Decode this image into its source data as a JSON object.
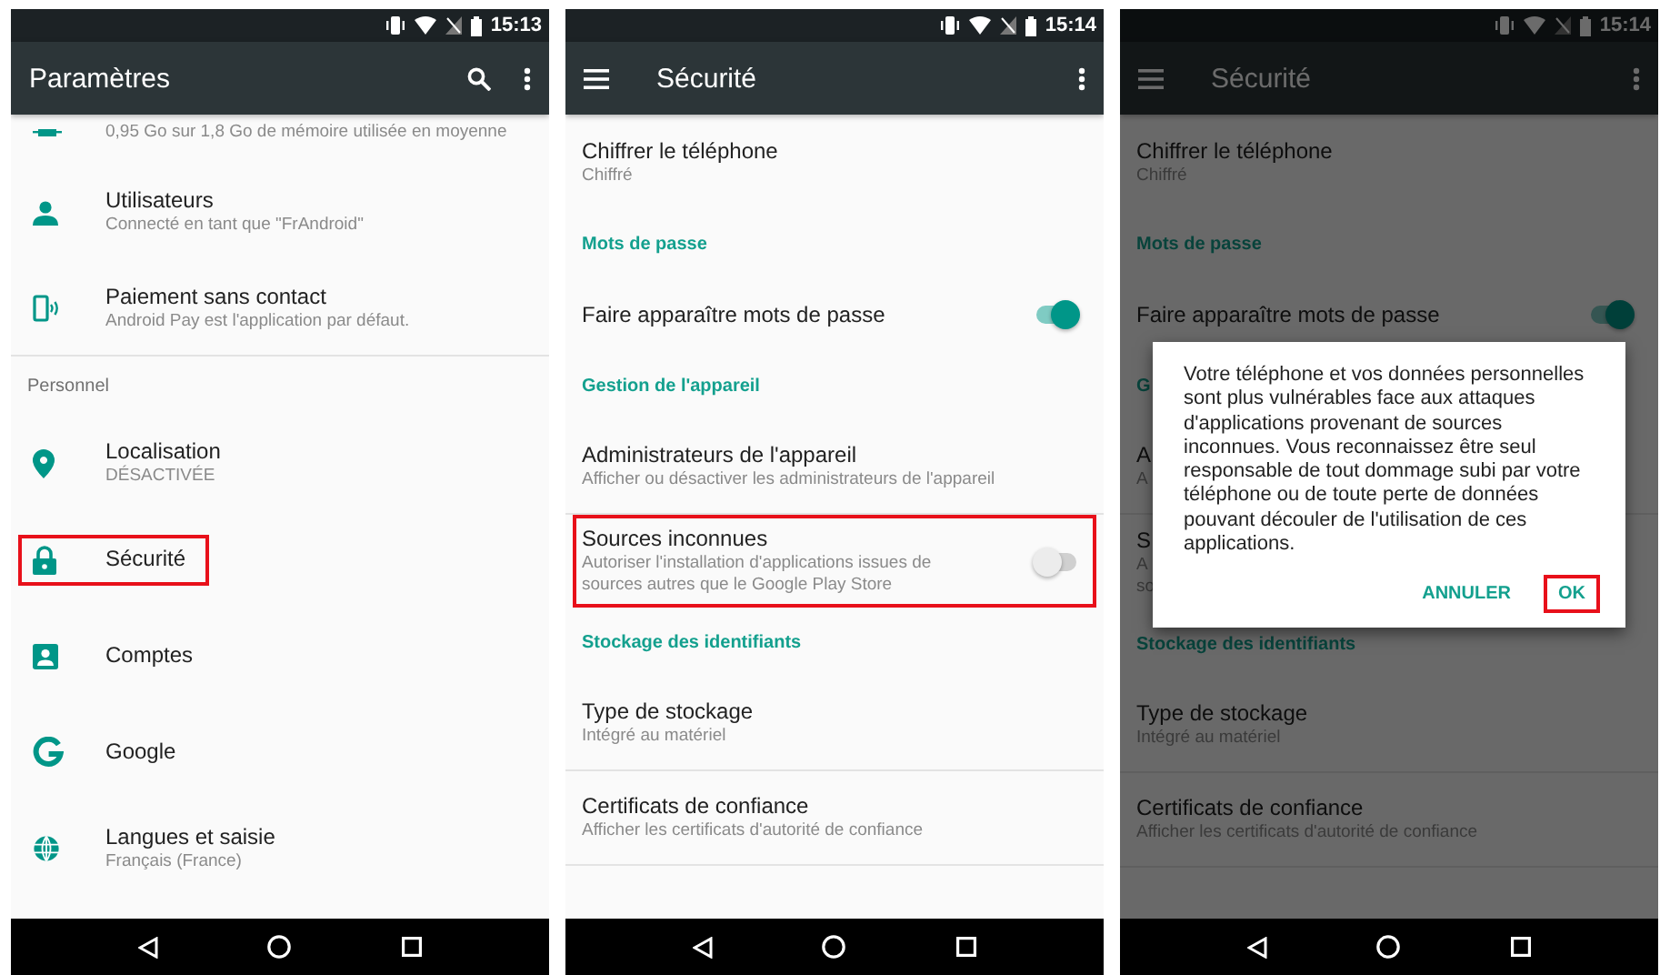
{
  "screens": [
    {
      "kind": "settings",
      "status_bar": {
        "time": "15:13"
      },
      "toolbar": {
        "title": "Paramètres"
      },
      "rows": [
        {
          "kind": "partial",
          "subtitle": [
            "0,95 Go sur 1,8 Go de mémoire utilisée en moyenne"
          ]
        },
        {
          "kind": "item",
          "title": "Utilisateurs",
          "subtitle": [
            "Connecté en tant que \"FrAndroid\""
          ]
        },
        {
          "kind": "item",
          "title": "Paiement sans contact",
          "subtitle": [
            "Android Pay est l'application par défaut."
          ],
          "divider": true
        },
        {
          "kind": "category",
          "title": "Personnel"
        },
        {
          "kind": "item",
          "title": "Localisation",
          "subtitle": [
            "DÉSACTIVÉE"
          ]
        },
        {
          "kind": "item",
          "title": "Sécurité",
          "highlighted": true
        },
        {
          "kind": "item",
          "title": "Comptes"
        },
        {
          "kind": "item",
          "title": "Google"
        },
        {
          "kind": "item",
          "title": "Langues et saisie",
          "subtitle": [
            "Français (France)"
          ]
        }
      ]
    },
    {
      "kind": "security",
      "status_bar": {
        "time": "15:14"
      },
      "toolbar": {
        "title": "Sécurité"
      },
      "rows": [
        {
          "kind": "item",
          "title": "Chiffrer le téléphone",
          "subtitle": [
            "Chiffré"
          ]
        },
        {
          "kind": "section",
          "title": "Mots de passe"
        },
        {
          "kind": "toggle",
          "title": "Faire apparaître mots de passe",
          "on": true
        },
        {
          "kind": "section",
          "title": "Gestion de l'appareil"
        },
        {
          "kind": "item",
          "title": "Administrateurs de l'appareil",
          "subtitle": [
            "Afficher ou désactiver les administrateurs de l'appareil"
          ],
          "divider": true
        },
        {
          "kind": "toggle",
          "title": "Sources inconnues",
          "subtitle": [
            "Autoriser l'installation d'applications issues de",
            "sources autres que le Google Play Store"
          ],
          "on": false,
          "highlighted": true
        },
        {
          "kind": "section",
          "title": "Stockage des identifiants"
        },
        {
          "kind": "item",
          "title": "Type de stockage",
          "subtitle": [
            "Intégré au matériel"
          ],
          "divider": true
        },
        {
          "kind": "item",
          "title": "Certificats de confiance",
          "subtitle": [
            "Afficher les certificats d'autorité de confiance"
          ],
          "divider": true
        }
      ]
    },
    {
      "kind": "security",
      "status_bar": {
        "time": "15:14"
      },
      "toolbar": {
        "title": "Sécurité"
      },
      "rows": [
        {
          "kind": "item",
          "title": "Chiffrer le téléphone",
          "subtitle": [
            "Chiffré"
          ]
        },
        {
          "kind": "section",
          "title": "Mots de passe"
        },
        {
          "kind": "toggle",
          "title": "Faire apparaître mots de passe",
          "on": true
        },
        {
          "kind": "section",
          "title": "G"
        },
        {
          "kind": "item",
          "title": "A",
          "subtitle": [
            "A"
          ],
          "divider": true
        },
        {
          "kind": "item",
          "title": "S",
          "subtitle": [
            "A",
            "so"
          ]
        },
        {
          "kind": "section",
          "title": "Stockage des identifiants"
        },
        {
          "kind": "item",
          "title": "Type de stockage",
          "subtitle": [
            "Intégré au matériel"
          ],
          "divider": true
        },
        {
          "kind": "item",
          "title": "Certificats de confiance",
          "subtitle": [
            "Afficher les certificats d'autorité de confiance"
          ],
          "divider": true
        }
      ],
      "dialog": {
        "message": "Votre téléphone et vos données personnelles sont plus vulnérables face aux attaques d'applications provenant de sources inconnues. Vous reconnaissez être seul responsable de tout dommage subi par votre téléphone ou de toute perte de données pouvant découler de l'utilisation de ces applications.",
        "buttons": [
          {
            "label": "ANNULER",
            "highlighted": false
          },
          {
            "label": "OK",
            "highlighted": true
          }
        ]
      }
    }
  ]
}
